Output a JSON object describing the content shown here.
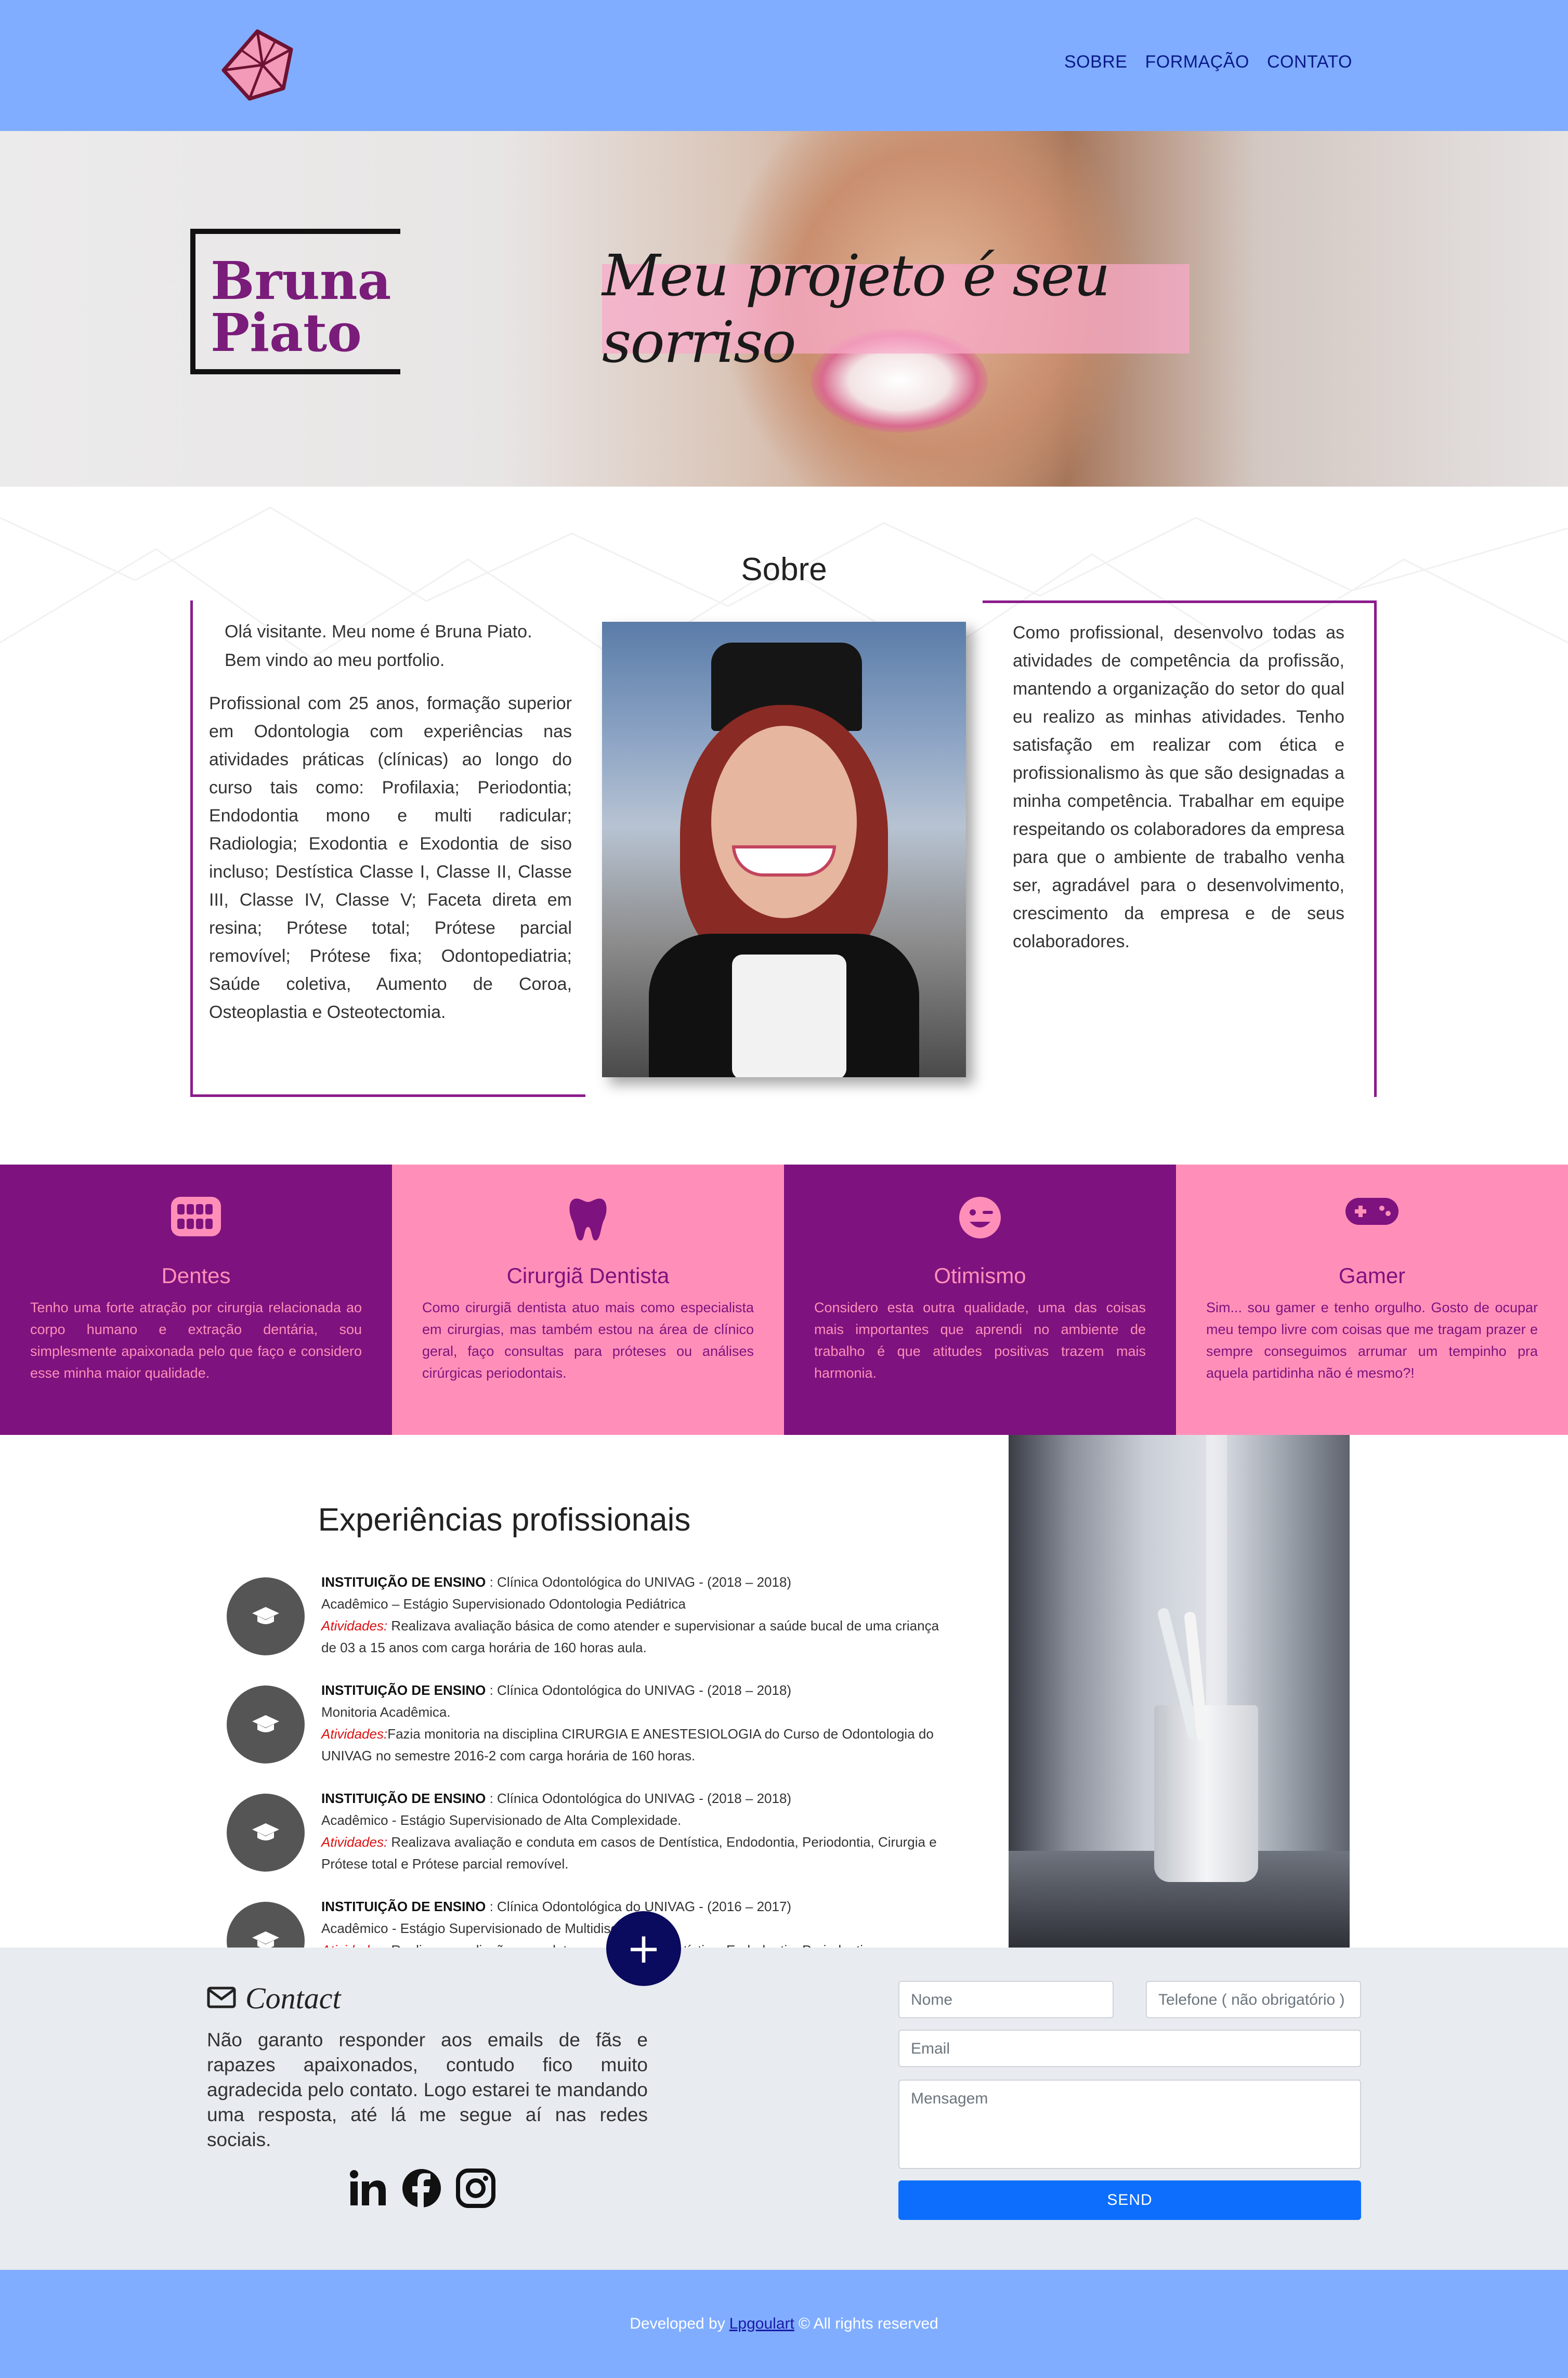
{
  "nav": {
    "links": [
      "SOBRE",
      "FORMAÇÃO",
      "CONTATO"
    ]
  },
  "hero": {
    "brand_line1": "Bruna",
    "brand_line2": "Piato",
    "tagline": "Meu projeto é seu sorriso"
  },
  "sobre": {
    "title": "Sobre",
    "greeting_line1": "Olá visitante. Meu nome é Bruna Piato.",
    "greeting_line2": "Bem vindo ao meu portfolio.",
    "left_text": "Profissional com 25 anos, formação superior em Odontologia com experiências nas atividades práticas (clínicas) ao longo do curso tais como: Profilaxia; Periodontia; Endodontia mono e multi radicular; Radiologia; Exodontia e Exodontia de siso incluso; Destística Classe I, Classe II, Classe III, Classe IV, Classe V; Faceta direta em resina; Prótese total; Prótese parcial removível; Prótese fixa; Odontopediatria; Saúde coletiva, Aumento de Coroa, Osteoplastia e Osteotectomia.",
    "right_text": "Como profissional, desenvolvo todas as atividades de competência da profissão, mantendo a organização do setor do qual eu realizo as minhas atividades. Tenho satisfação em realizar com ética e profissionalismo às que são designadas a minha competência. Trabalhar em equipe respeitando os colaboradores da empresa para que o ambiente de trabalho venha ser, agradável para o desenvolvimento, crescimento da empresa e de seus colaboradores."
  },
  "features": [
    {
      "icon": "teeth-icon",
      "title": "Dentes",
      "text": "Tenho uma forte atração por cirurgia relacionada ao corpo humano e extração dentária, sou simplesmente apaixonada pelo que faço e considero esse minha maior qualidade."
    },
    {
      "icon": "tooth-icon",
      "title": "Cirurgiã Dentista",
      "text": "Como cirurgiã dentista atuo mais como especialista em cirurgias, mas também estou na área de clínico geral, faço consultas para próteses ou análises cirúrgicas periodontais."
    },
    {
      "icon": "wink-face-icon",
      "title": "Otimismo",
      "text": "Considero esta outra qualidade, uma das coisas mais importantes que aprendi no ambiente de trabalho é que atitudes positivas trazem mais harmonia."
    },
    {
      "icon": "gamepad-icon",
      "title": "Gamer",
      "text": "Sim... sou gamer e tenho orgulho. Gosto de ocupar meu tempo livre com coisas que me tragam prazer e sempre conseguimos arrumar um tempinho pra aquela partidinha não é mesmo?!"
    }
  ],
  "experience": {
    "title": "Experiências profissionais",
    "label_institution": "INSTITUIÇÃO DE ENSINO",
    "label_activities": "Atividades:",
    "items": [
      {
        "place": ": Clínica Odontológica do UNIVAG - (2018 – 2018)",
        "role": "Acadêmico – Estágio Supervisionado Odontologia Pediátrica",
        "activities": " Realizava avaliação básica de como atender e supervisionar a saúde bucal de uma criança de 03 a 15 anos com carga horária de 160 horas aula."
      },
      {
        "place": ": Clínica Odontológica do UNIVAG - (2018 – 2018)",
        "role": "Monitoria Acadêmica.",
        "activities": "Fazia monitoria na disciplina CIRURGIA E ANESTESIOLOGIA do Curso de Odontologia do UNIVAG no semestre 2016-2 com carga horária de 160 horas."
      },
      {
        "place": ": Clínica Odontológica do UNIVAG - (2018 – 2018)",
        "role": "Acadêmico - Estágio Supervisionado de Alta Complexidade.",
        "activities": " Realizava avaliação e conduta em casos de Dentística, Endodontia, Periodontia, Cirurgia e Prótese total e Prótese parcial removível."
      },
      {
        "place": ": Clínica Odontológica do UNIVAG - (2016 – 2017)",
        "role": "Acadêmico - Estágio Supervisionado de Multidisciplinal.",
        "activities": " Realizava avaliação e conduta em casos de Dentística, Endodontia, Periodontia"
      }
    ]
  },
  "contact": {
    "title": "Contact",
    "text": "Não garanto responder aos emails de fãs e rapazes apaixonados, contudo fico muito agradecida pelo contato. Logo estarei te mandando uma resposta, até lá me segue aí nas redes sociais.",
    "plus": "+",
    "fields": {
      "name_placeholder": "Nome",
      "phone_placeholder": "Telefone ( não obrigatório )",
      "email_placeholder": "Email",
      "message_placeholder": "Mensagem"
    },
    "send_label": "SEND",
    "socials": [
      "linkedin-icon",
      "facebook-icon",
      "instagram-icon"
    ]
  },
  "footer": {
    "prefix": "Developed by",
    "author": "Lpgoulart",
    "suffix": "© All rights reserved"
  },
  "colors": {
    "nav_bg": "#80adff",
    "purple": "#7e127e",
    "pink": "#ff8fb9",
    "send": "#0d6efd",
    "plus_button": "#0a0a5e"
  }
}
